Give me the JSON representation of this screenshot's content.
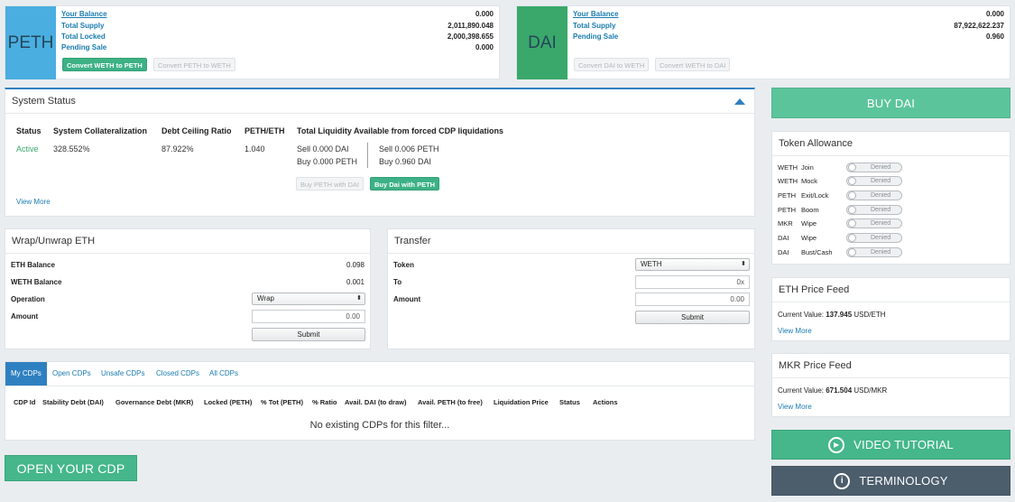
{
  "peth": {
    "symbol": "PETH",
    "rows": [
      {
        "label": "Your Balance",
        "value": "0.000"
      },
      {
        "label": "Total Supply",
        "value": "2,011,890.048"
      },
      {
        "label": "Total Locked",
        "value": "2,000,398.655"
      },
      {
        "label": "Pending Sale",
        "value": "0.000"
      }
    ],
    "btn_convert_weth": "Convert WETH to PETH",
    "btn_convert_peth": "Convert PETH to WETH"
  },
  "dai": {
    "symbol": "DAI",
    "rows": [
      {
        "label": "Your Balance",
        "value": "0.000"
      },
      {
        "label": "Total Supply",
        "value": "87,922,622.237"
      },
      {
        "label": "Pending Sale",
        "value": "0.960"
      }
    ],
    "btn_convert_dai": "Convert DAI to WETH",
    "btn_convert_weth": "Convert WETH to DAI"
  },
  "system_status": {
    "title": "System Status",
    "headers": {
      "status": "Status",
      "collat": "System Collateralization",
      "debt": "Debt Ceiling Ratio",
      "peth_eth": "PETH/ETH",
      "liquidity": "Total Liquidity Available from forced CDP liquidations"
    },
    "values": {
      "status": "Active",
      "collat": "328.552%",
      "debt": "87.922%",
      "peth_eth": "1.040"
    },
    "sell_dai": "Sell 0.000 DAI",
    "buy_peth": "Buy 0.000 PETH",
    "sell_peth": "Sell 0.006 PETH",
    "buy_dai": "Buy 0.960 DAI",
    "btn_buy_peth": "Buy PETH with DAI",
    "btn_buy_dai": "Buy Dai with PETH",
    "view_more": "View More"
  },
  "wrap": {
    "title": "Wrap/Unwrap ETH",
    "eth_label": "ETH Balance",
    "eth_value": "0.098",
    "weth_label": "WETH Balance",
    "weth_value": "0.001",
    "op_label": "Operation",
    "op_value": "Wrap",
    "amount_label": "Amount",
    "amount_placeholder": "0.00",
    "submit": "Submit"
  },
  "transfer": {
    "title": "Transfer",
    "token_label": "Token",
    "token_value": "WETH",
    "to_label": "To",
    "to_placeholder": "0x",
    "amount_label": "Amount",
    "amount_placeholder": "0.00",
    "submit": "Submit"
  },
  "cdps": {
    "tabs": [
      "My CDPs",
      "Open CDPs",
      "Unsafe CDPs",
      "Closed CDPs",
      "All CDPs"
    ],
    "columns": [
      "CDP Id",
      "Stability Debt (DAI)",
      "Governance Debt (MKR)",
      "Locked (PETH)",
      "% Tot (PETH)",
      "% Ratio",
      "Avail. DAI (to draw)",
      "Avail. PETH (to free)",
      "Liquidation Price",
      "Status",
      "Actions"
    ],
    "empty": "No existing CDPs for this filter..."
  },
  "open_cdp": "OPEN YOUR CDP",
  "buy_dai": "BUY DAI",
  "allowance": {
    "title": "Token Allowance",
    "rows": [
      {
        "token": "WETH",
        "action": "Join",
        "state": "Denied"
      },
      {
        "token": "WETH",
        "action": "Mock",
        "state": "Denied"
      },
      {
        "token": "PETH",
        "action": "Exit/Lock",
        "state": "Denied"
      },
      {
        "token": "PETH",
        "action": "Boom",
        "state": "Denied"
      },
      {
        "token": "MKR",
        "action": "Wipe",
        "state": "Denied"
      },
      {
        "token": "DAI",
        "action": "Wipe",
        "state": "Denied"
      },
      {
        "token": "DAI",
        "action": "Bust/Cash",
        "state": "Denied"
      }
    ]
  },
  "eth_feed": {
    "title": "ETH Price Feed",
    "label": "Current Value:",
    "value": "137.945",
    "unit": "USD/ETH",
    "view_more": "View More"
  },
  "mkr_feed": {
    "title": "MKR Price Feed",
    "label": "Current Value:",
    "value": "671.504",
    "unit": "USD/MKR",
    "view_more": "View More"
  },
  "video_tutorial": "VIDEO TUTORIAL",
  "terminology": "TERMINOLOGY",
  "colors": {
    "peth_tile": "#4aaee0",
    "dai_tile": "#3aa86a",
    "accent_green": "#45b78a",
    "terminology_bg": "#4c5d6c"
  }
}
